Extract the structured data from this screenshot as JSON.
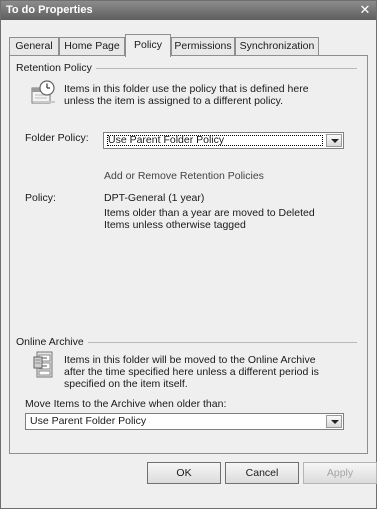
{
  "window": {
    "title": "To do Properties",
    "close_glyph": "✕"
  },
  "tabs": [
    {
      "label": "General"
    },
    {
      "label": "Home Page"
    },
    {
      "label": "Policy",
      "active": true
    },
    {
      "label": "Permissions"
    },
    {
      "label": "Synchronization"
    }
  ],
  "retention": {
    "group_title": "Retention Policy",
    "description_line1": "Items in this folder use the policy that is defined here",
    "description_line2": "unless the item is assigned to a different policy.",
    "folder_policy_label": "Folder Policy:",
    "folder_policy_value": "Use Parent Folder Policy",
    "add_remove_link": "Add or Remove Retention Policies",
    "policy_label": "Policy:",
    "policy_name": "DPT-General (1 year)",
    "policy_desc_line1": "Items older than a year are moved to Deleted",
    "policy_desc_line2": "Items unless otherwise tagged",
    "icon": "clock-calendar-icon"
  },
  "archive": {
    "group_title": "Online Archive",
    "description_line1": "Items in this folder will be moved to the Online Archive",
    "description_line2": "after the time specified here unless a different period is",
    "description_line3": "specified on the item itself.",
    "move_label": "Move Items to the Archive when older than:",
    "move_value": "Use Parent Folder Policy",
    "icon": "archive-cabinet-icon"
  },
  "buttons": {
    "ok": "OK",
    "cancel": "Cancel",
    "apply": "Apply"
  }
}
